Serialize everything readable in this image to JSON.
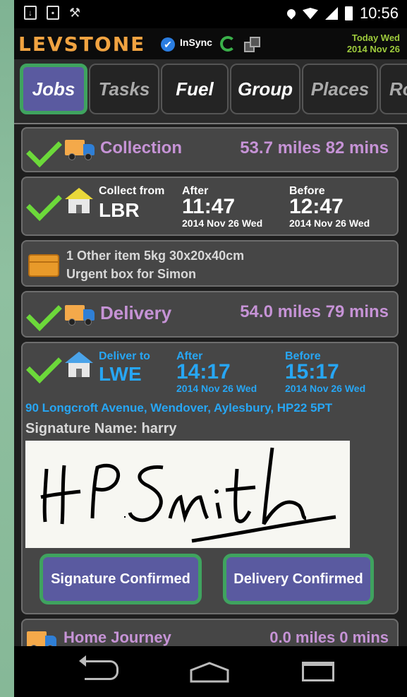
{
  "status_bar": {
    "time": "10:56",
    "left_icons": [
      "download-icon",
      "image-icon",
      "tool-icon"
    ],
    "right_icons": [
      "location-icon",
      "wifi-icon",
      "signal-icon",
      "battery-icon"
    ]
  },
  "header": {
    "logo": "LEVSTONE",
    "sync_label": "InSync",
    "date_line1": "Today Wed",
    "date_line2": "2014 Nov 26"
  },
  "tabs": [
    {
      "label": "Jobs",
      "active": true
    },
    {
      "label": "Tasks",
      "active": false
    },
    {
      "label": "Fuel",
      "active": false
    },
    {
      "label": "Group",
      "active": false
    },
    {
      "label": "Places",
      "active": false
    },
    {
      "label": "Ro",
      "active": false
    }
  ],
  "collection": {
    "title": "Collection",
    "summary": "53.7 miles 82 mins"
  },
  "collect_from": {
    "label": "Collect from",
    "code": "LBR",
    "after_label": "After",
    "after_time": "11:47",
    "after_date": "2014 Nov 26 Wed",
    "before_label": "Before",
    "before_time": "12:47",
    "before_date": "2014 Nov 26 Wed"
  },
  "item": {
    "line1": "1 Other item 5kg 30x20x40cm",
    "line2": "Urgent box for Simon"
  },
  "delivery": {
    "title": "Delivery",
    "summary": "54.0 miles 79 mins"
  },
  "deliver_to": {
    "label": "Deliver to",
    "code": "LWE",
    "after_label": "After",
    "after_time": "14:17",
    "after_date": "2014 Nov 26 Wed",
    "before_label": "Before",
    "before_time": "15:17",
    "before_date": "2014 Nov 26 Wed",
    "address": "90 Longcroft Avenue, Wendover, Aylesbury, HP22 5PT",
    "signature_name": "Signature Name: harry",
    "signature_text": "H P Smith"
  },
  "buttons": {
    "signature_confirmed": "Signature Confirmed",
    "delivery_confirmed": "Delivery Confirmed"
  },
  "home_journey": {
    "title": "Home Journey",
    "summary": "0.0 miles 0 mins"
  },
  "colors": {
    "accent_purple": "#c693d6",
    "link_blue": "#27a6f4",
    "check_green": "#6cd93a",
    "tab_active_bg": "#5a5aa0",
    "tab_active_border": "#3fa35f",
    "logo_orange": "#f1a341"
  }
}
